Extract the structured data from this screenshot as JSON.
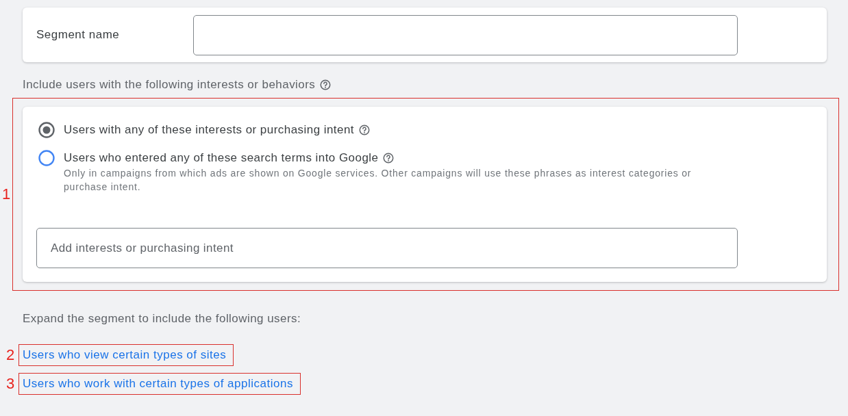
{
  "segment_name": {
    "label": "Segment name"
  },
  "interests_section": {
    "heading": "Include users with the following interests or behaviors",
    "annotation": "1",
    "options": [
      {
        "label": "Users with any of these interests or purchasing intent",
        "selected": true
      },
      {
        "label": "Users who entered any of these search terms into Google",
        "selected": false,
        "note": "Only in campaigns from which ads are shown on Google services. Other campaigns will use these phrases as interest categories or purchase intent."
      }
    ],
    "input": {
      "placeholder": "Add interests or purchasing intent"
    }
  },
  "expand_section": {
    "heading": "Expand the segment to include the following users:",
    "links": [
      {
        "text": "Users who view certain types of sites",
        "annotation": "2"
      },
      {
        "text": "Users who work with certain types of applications",
        "annotation": "3"
      }
    ]
  }
}
